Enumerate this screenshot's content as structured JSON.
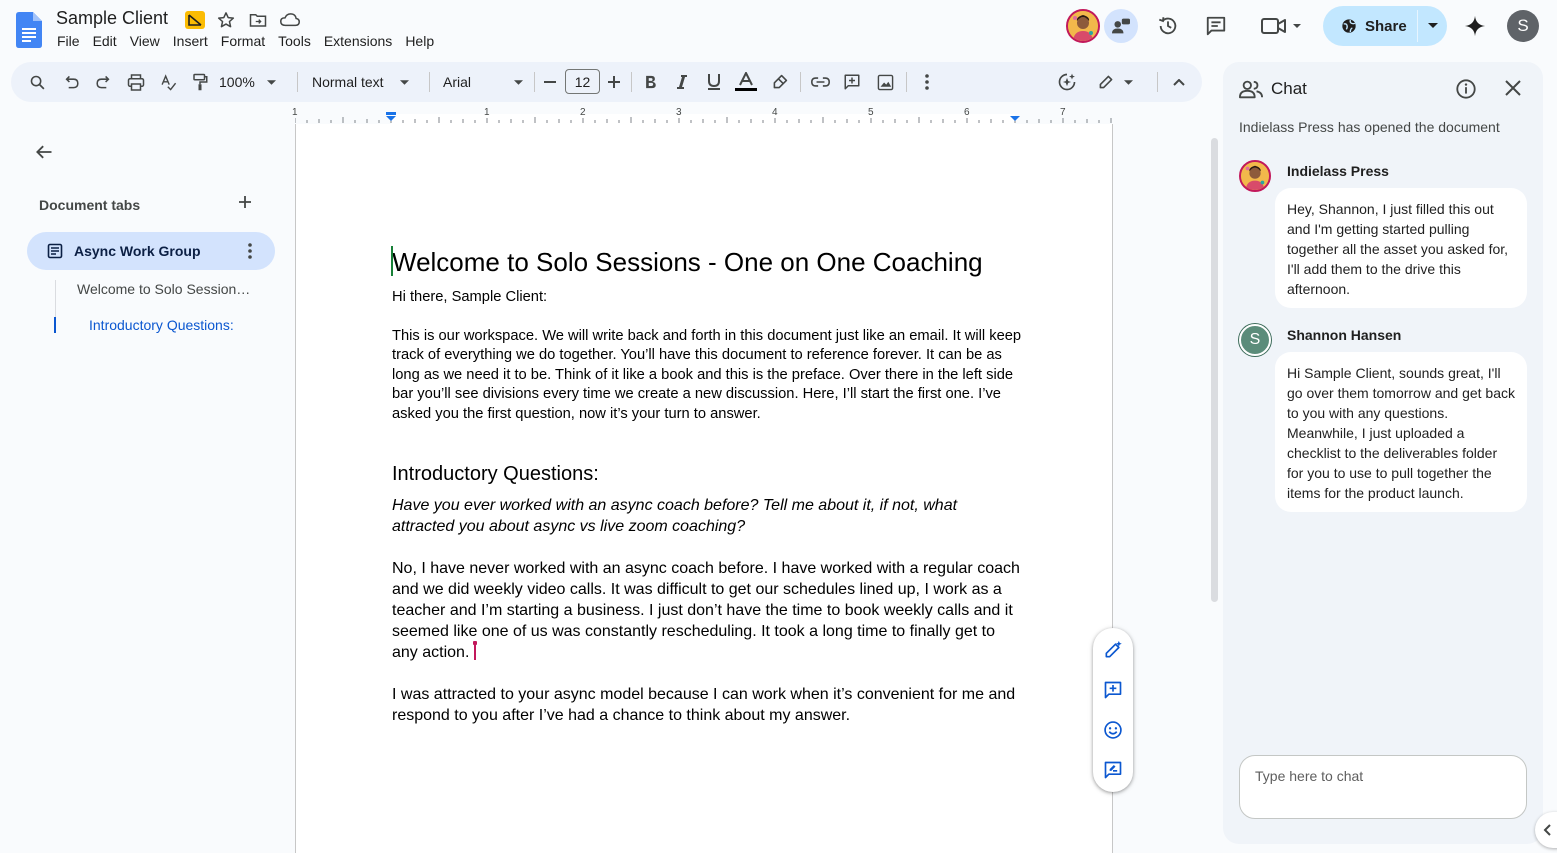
{
  "app": {
    "doc_title": "Sample Client",
    "menu": [
      "File",
      "Edit",
      "View",
      "Insert",
      "Format",
      "Tools",
      "Extensions",
      "Help"
    ],
    "share_label": "Share",
    "user_initial": "S"
  },
  "toolbar": {
    "zoom": "100%",
    "style": "Normal text",
    "font": "Arial",
    "font_size": "12"
  },
  "ruler": {
    "numbers": [
      "1",
      "1",
      "2",
      "3",
      "4",
      "5",
      "6",
      "7"
    ]
  },
  "left_panel": {
    "heading": "Document tabs",
    "active_tab": "Async Work Group",
    "outline": [
      "Welcome to Solo Sessions - One on One Coaching",
      "Introductory Questions:"
    ]
  },
  "document": {
    "title": "Welcome to Solo Sessions - One on One Coaching",
    "greeting": "Hi there, Sample Client:",
    "intro": "This is our workspace. We will write back and forth in this document just like an email. It will keep track of everything we do together. You’ll have this document to reference forever. It can be as long as we need it to be. Think of it like a book and this is the preface. Over there in the left side bar you’ll see divisions every time we create a new discussion. Here, I’ll start the first one. I’ve asked you the first question, now it’s your turn to answer.",
    "heading2": "Introductory Questions:",
    "question": "Have you ever worked with an async coach before? Tell me about it, if not, what attracted you about async vs live zoom coaching?",
    "answer1": "No, I have never worked with an async coach before. I have worked with a regular coach and we did weekly video calls. It was difficult to get our schedules lined up, I work as a teacher and I’m starting a business. I just don’t have the time to book weekly calls and it seemed like one of us was constantly rescheduling. It took a long time to finally get to any action.",
    "answer2": "I was attracted to your async model because I can work when it’s convenient for me and respond to you after I’ve had a chance to think about my answer."
  },
  "chat": {
    "title": "Chat",
    "system_message": "Indielass Press has opened the document",
    "messages": [
      {
        "sender": "Indielass Press",
        "text": "Hey, Shannon, I just filled this out and I'm getting started pulling together all the asset you asked for, I'll add them to the drive this afternoon."
      },
      {
        "sender": "Shannon Hansen",
        "initial": "S",
        "text": "Hi Sample Client, sounds great, I'll go over them tomorrow and get back to you with any questions. Meanwhile, I just uploaded a checklist to the deliverables folder for you to use to pull together the items for the product launch."
      }
    ],
    "input_placeholder": "Type here to chat"
  },
  "colors": {
    "accent_blue": "#0b57d0",
    "share_bg": "#c2e7ff",
    "tab_active_bg": "#d3e3fd",
    "toolbar_bg": "#edf2fa",
    "chat_bg": "#f0f4f9",
    "docs_logo": "#4285f4"
  },
  "icons": [
    "docs-logo",
    "slides-badge-icon",
    "star-icon",
    "move-folder-icon",
    "cloud-saved-icon",
    "history-icon",
    "comments-icon",
    "meet-icon",
    "globe-icon",
    "gemini-icon",
    "search-icon",
    "undo-icon",
    "redo-icon",
    "print-icon",
    "spellcheck-icon",
    "paint-format-icon",
    "bold-icon",
    "italic-icon",
    "underline-icon",
    "text-color-icon",
    "highlight-icon",
    "link-icon",
    "add-comment-icon",
    "image-icon",
    "more-icon",
    "ai-assist-icon",
    "edit-mode-icon",
    "people-icon",
    "info-icon",
    "close-icon",
    "back-arrow-icon",
    "emoji-icon",
    "suggest-edit-icon"
  ]
}
